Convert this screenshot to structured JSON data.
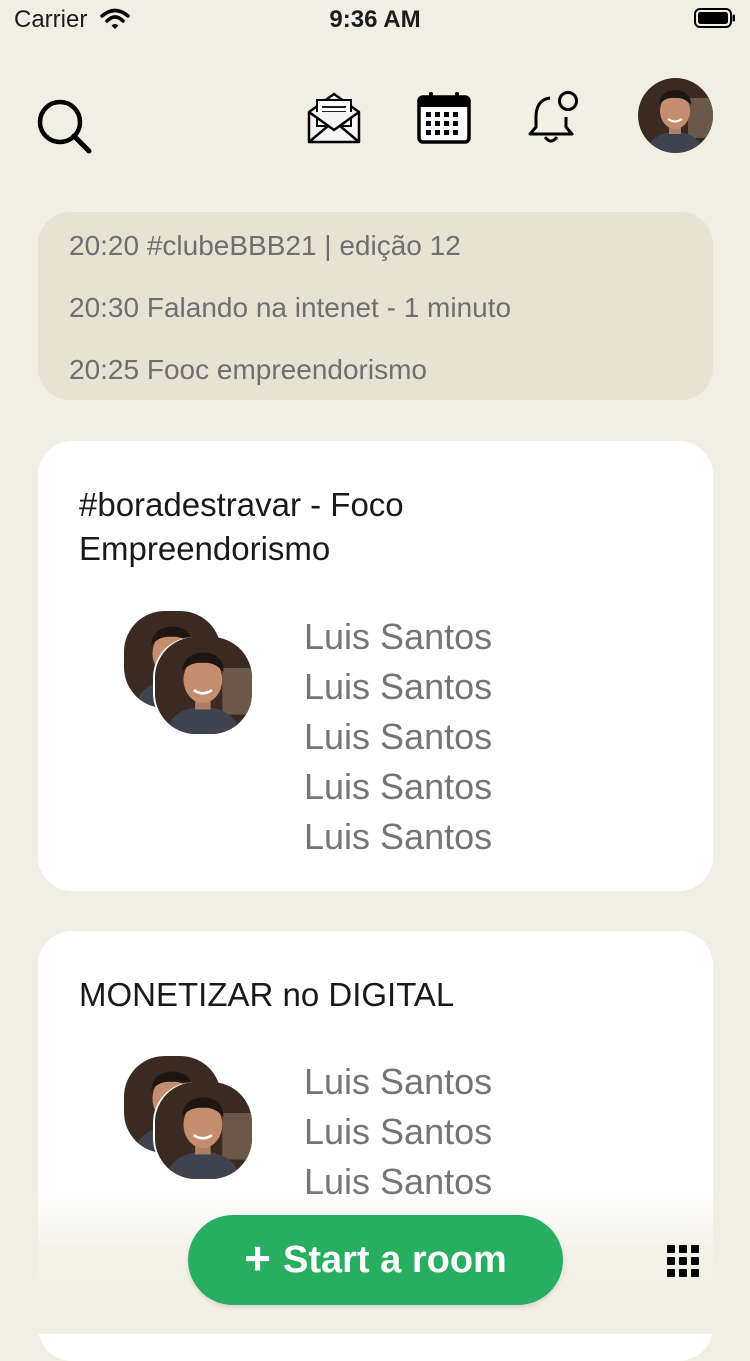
{
  "status_bar": {
    "carrier": "Carrier",
    "time": "9:36 AM"
  },
  "header": {
    "icons": [
      "search-icon",
      "mail-icon",
      "calendar-icon",
      "bell-icon",
      "profile-avatar"
    ]
  },
  "upcoming": [
    {
      "text": "20:20 #clubeBBB21 | edição 12"
    },
    {
      "text": "20:30 Falando na intenet - 1 minuto"
    },
    {
      "text": "20:25 Fooc empreendorismo"
    }
  ],
  "rooms": [
    {
      "title": "#boradestravar - Foco Empreendorismo",
      "speakers": [
        "Luis Santos",
        "Luis Santos",
        "Luis Santos",
        "Luis Santos",
        "Luis Santos"
      ]
    },
    {
      "title": "MONETIZAR no DIGITAL",
      "speakers": [
        "Luis Santos",
        "Luis Santos",
        "Luis Santos"
      ]
    }
  ],
  "bottom": {
    "start_room_label": "Start a room",
    "start_room_plus": "+"
  },
  "colors": {
    "background": "#f1efe4",
    "accent": "#27ae60",
    "upcoming_bg": "#e6e3d5"
  }
}
